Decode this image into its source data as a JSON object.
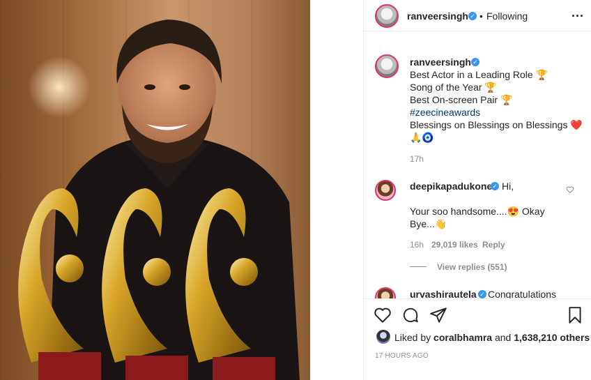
{
  "photo": {
    "alt_scene": "man with three gold trophies"
  },
  "header": {
    "username": "ranveersingh",
    "separator": "•",
    "follow_label": "Following",
    "more_label": "..."
  },
  "caption": {
    "username": "ranveersingh",
    "lines": [
      "Best Actor in a Leading Role 🏆",
      "Song of the Year 🏆",
      "Best On-screen Pair 🏆",
      "#zeecineawards",
      "Blessings on Blessings on Blessings ❤️",
      "🙏🧿"
    ],
    "time": "17h"
  },
  "comment": {
    "username": "deepikapadukone",
    "text_line1": "Hi,",
    "text_line2": "Your soo handsome....😍 Okay",
    "text_line3": "Bye...👋",
    "time": "16h",
    "likes": "29,019 likes",
    "reply_label": "Reply",
    "view_replies": "View replies (551)"
  },
  "next_comment": {
    "username": "urvashirautela",
    "text": "Congratulations"
  },
  "actions": {
    "liked_prefix": "Liked by ",
    "liked_user": "coralbhamra",
    "liked_middle": " and ",
    "liked_count": "1,638,210 others",
    "timestamp": "17 HOURS AGO"
  },
  "colors": {
    "accent": "#3897f0",
    "ring": "#e1306c",
    "muted": "#8e8e8e",
    "hashtag": "#00376b"
  }
}
